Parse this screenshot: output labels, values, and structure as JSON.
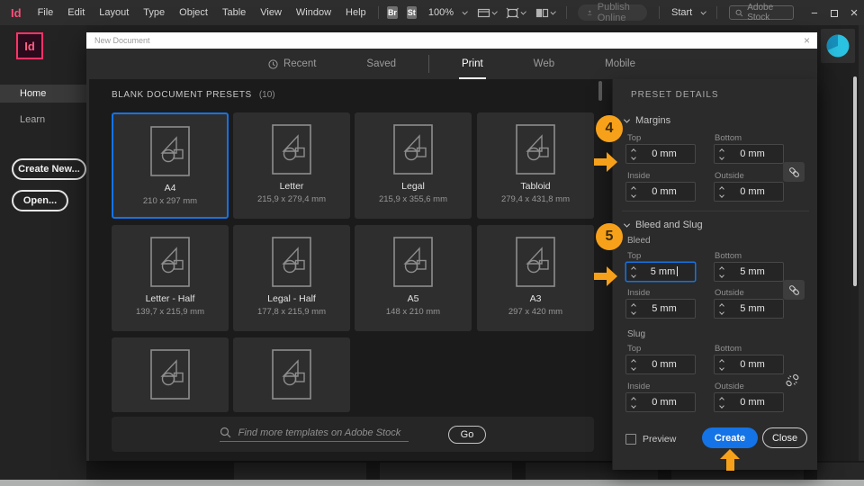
{
  "colors": {
    "accent_blue": "#1473E6",
    "annotation_orange": "#F7A11A",
    "brand_pink": "#FF3366",
    "avatar_cyan": "#2BC3E4"
  },
  "menubar": {
    "app_icon": "Id",
    "items": [
      "File",
      "Edit",
      "Layout",
      "Type",
      "Object",
      "Table",
      "View",
      "Window",
      "Help"
    ],
    "bridge_badge": "Br",
    "stock_badge": "St",
    "zoom_level": "100%",
    "publish_online_label": "Publish Online",
    "start_label": "Start",
    "stock_search_placeholder": "Adobe Stock"
  },
  "sidebar": {
    "app_tile": "Id",
    "items": [
      {
        "label": "Home",
        "active": true
      },
      {
        "label": "Learn",
        "active": false
      }
    ],
    "create_new_label": "Create New...",
    "open_label": "Open..."
  },
  "dialog": {
    "title": "New Document",
    "tabs": [
      {
        "label": "Recent"
      },
      {
        "label": "Saved"
      },
      {
        "label": "Print",
        "active": true
      },
      {
        "label": "Web"
      },
      {
        "label": "Mobile"
      }
    ],
    "presets_header": "BLANK DOCUMENT PRESETS",
    "presets_count": "(10)",
    "presets": [
      {
        "name": "A4",
        "size": "210 x 297 mm",
        "selected": true
      },
      {
        "name": "Letter",
        "size": "215,9 x 279,4 mm"
      },
      {
        "name": "Legal",
        "size": "215,9 x 355,6 mm"
      },
      {
        "name": "Tabloid",
        "size": "279,4 x 431,8 mm"
      },
      {
        "name": "Letter - Half",
        "size": "139,7 x 215,9 mm"
      },
      {
        "name": "Legal - Half",
        "size": "177,8 x 215,9 mm"
      },
      {
        "name": "A5",
        "size": "148 x 210 mm"
      },
      {
        "name": "A3",
        "size": "297 x 420 mm"
      }
    ],
    "search_placeholder": "Find more templates on Adobe Stock",
    "go_label": "Go"
  },
  "preset_details": {
    "header": "PRESET DETAILS",
    "margins": {
      "title": "Margins",
      "fields": [
        {
          "label": "Top",
          "value": "0 mm"
        },
        {
          "label": "Bottom",
          "value": "0 mm"
        },
        {
          "label": "Inside",
          "value": "0 mm"
        },
        {
          "label": "Outside",
          "value": "0 mm"
        }
      ]
    },
    "bleed_and_slug": {
      "title": "Bleed and Slug",
      "bleed_label": "Bleed",
      "bleed_fields": [
        {
          "label": "Top",
          "value": "5 mm",
          "focused": true
        },
        {
          "label": "Bottom",
          "value": "5 mm"
        },
        {
          "label": "Inside",
          "value": "5 mm"
        },
        {
          "label": "Outside",
          "value": "5 mm"
        }
      ],
      "slug_label": "Slug",
      "slug_fields": [
        {
          "label": "Top",
          "value": "0 mm"
        },
        {
          "label": "Bottom",
          "value": "0 mm"
        },
        {
          "label": "Inside",
          "value": "0 mm"
        },
        {
          "label": "Outside",
          "value": "0 mm"
        }
      ]
    },
    "preview_label": "Preview",
    "create_label": "Create",
    "close_label": "Close"
  },
  "annotations": {
    "step_4": "4",
    "step_5": "5"
  }
}
